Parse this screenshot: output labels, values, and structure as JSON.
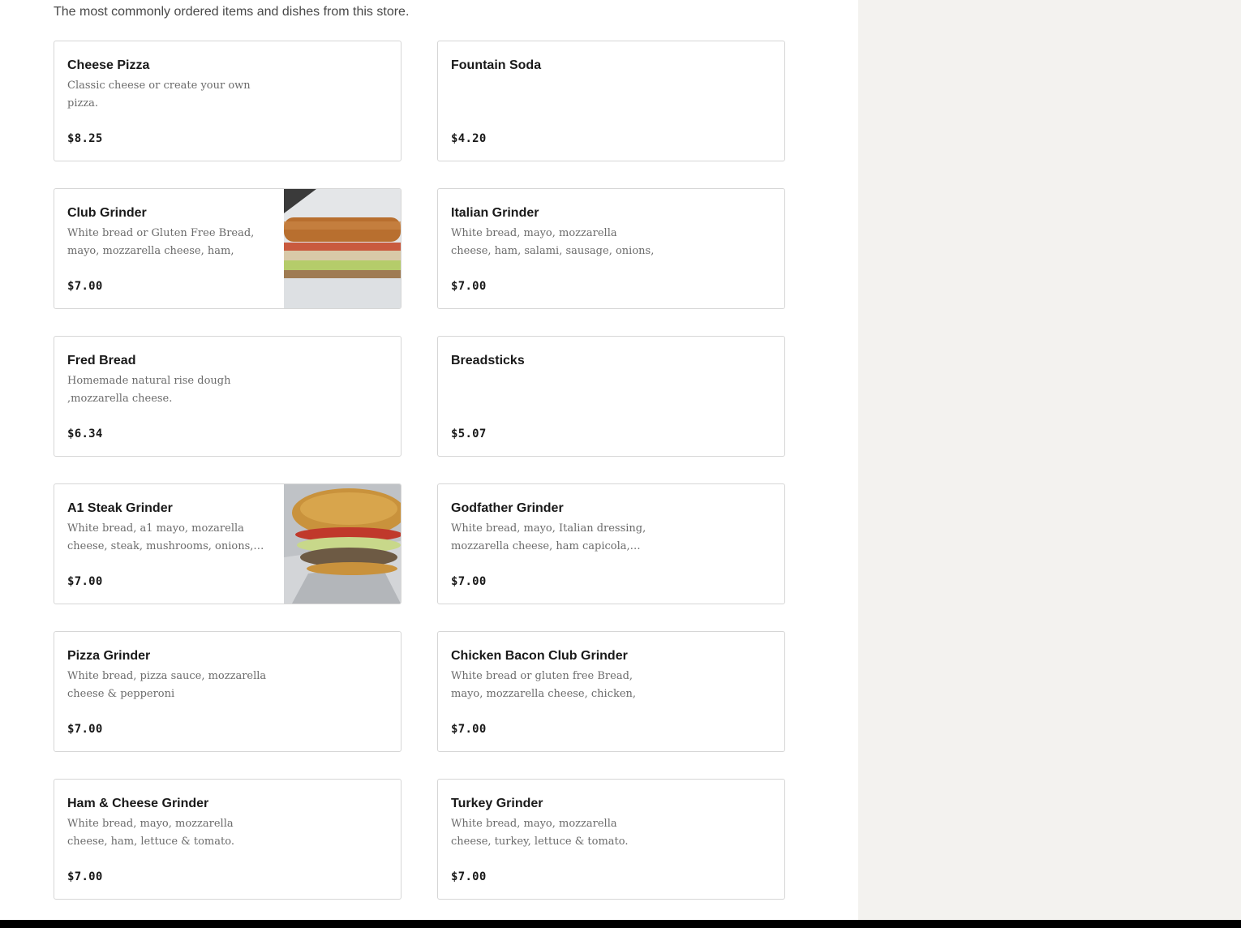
{
  "header": {
    "subtitle": "The most commonly ordered items and dishes from this store."
  },
  "items": [
    {
      "name": "Cheese Pizza",
      "description": "Classic cheese or create your own pizza.",
      "price": "$8.25",
      "image": ""
    },
    {
      "name": "Fountain Soda",
      "description": "",
      "price": "$4.20",
      "image": ""
    },
    {
      "name": "Club Grinder",
      "description": "White bread or Gluten Free Bread, mayo, mozzarella cheese, ham, turkey…",
      "price": "$7.00",
      "image": "sandwich-photo-club"
    },
    {
      "name": "Italian Grinder",
      "description": "White bread, mayo, mozzarella cheese, ham, salami, sausage, onions, green…",
      "price": "$7.00",
      "image": ""
    },
    {
      "name": "Fred Bread",
      "description": "Homemade natural rise dough ,mozzarella cheese.",
      "price": "$6.34",
      "image": ""
    },
    {
      "name": "Breadsticks",
      "description": "",
      "price": "$5.07",
      "image": ""
    },
    {
      "name": "A1 Steak Grinder",
      "description": "White bread, a1 mayo, mozarella cheese, steak, mushrooms, onions,…",
      "price": "$7.00",
      "image": "sandwich-photo-steak"
    },
    {
      "name": "Godfather Grinder",
      "description": "White bread, mayo, Italian dressing, mozzarella cheese, ham capicola,…",
      "price": "$7.00",
      "image": ""
    },
    {
      "name": "Pizza Grinder",
      "description": "White bread, pizza sauce, mozzarella cheese & pepperoni",
      "price": "$7.00",
      "image": ""
    },
    {
      "name": "Chicken Bacon Club Grinder",
      "description": "White bread or gluten free Bread, mayo, mozzarella cheese, chicken, bacon,…",
      "price": "$7.00",
      "image": ""
    },
    {
      "name": "Ham & Cheese Grinder",
      "description": "White bread, mayo, mozzarella cheese, ham, lettuce & tomato.",
      "price": "$7.00",
      "image": ""
    },
    {
      "name": "Turkey Grinder",
      "description": "White bread, mayo, mozzarella cheese, turkey, lettuce & tomato.",
      "price": "$7.00",
      "image": ""
    }
  ],
  "colors": {
    "sidebar_background": "#f3f2ef",
    "border": "#d6d6d6",
    "footer": "#000000"
  }
}
